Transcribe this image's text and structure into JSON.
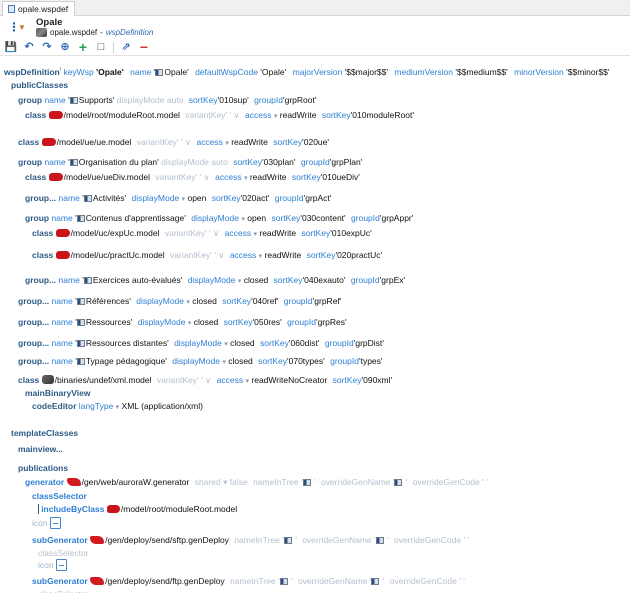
{
  "tab": {
    "label": "opale.wspdef"
  },
  "header": {
    "title": "Opale",
    "doc_name": "opale.wspdef",
    "doc_subtitle": "wspDefinition"
  },
  "root": {
    "tag": "wspDefinition",
    "keyWsp": "Opale",
    "name": "Opale",
    "defaultWspCode": "Opale",
    "majorVersion": "$$major$$",
    "mediumVersion": "$$medium$$",
    "minorVersion": "$$minor$$"
  },
  "labels": {
    "publicClasses": "publicClasses",
    "templateClasses": "templateClasses",
    "mainview": "mainview...",
    "publications": "publications",
    "group": "group",
    "group_trunc": "group...",
    "class": "class",
    "mainBinaryView": "mainBinaryView",
    "codeEditor": "codeEditor",
    "classSelector": "classSelector",
    "includeByClass": "includeByClass",
    "generator": "generator",
    "subGenerator": "subGenerator",
    "icon": "icon",
    "empty_q": "' '",
    "chev": "∨",
    "caret": "▾"
  },
  "attrs": {
    "name": "name",
    "displayMode": "displayMode",
    "sortKey": "sortKey",
    "groupId": "groupId",
    "variantKey": "variantKey",
    "access": "access",
    "langType": "langType",
    "keyWsp": "keyWsp",
    "defaultWspCode": "defaultWspCode",
    "majorVersion": "majorVersion",
    "mediumVersion": "mediumVersion",
    "minorVersion": "minorVersion",
    "shared": "shared",
    "nameInTree": "nameInTree",
    "overrideGenName": "overrideGenName",
    "overrideGenCode": "overrideGenCode"
  },
  "groups": {
    "supports": {
      "name": "Supports",
      "displayMode": "auto",
      "sortKey": "010sup",
      "groupId": "grpRoot"
    },
    "plan": {
      "name": "Organisation du plan",
      "displayMode": "auto",
      "sortKey": "030plan",
      "groupId": "grpPlan"
    },
    "activites": {
      "name": "Activités",
      "displayMode": "open",
      "sortKey": "020act",
      "groupId": "grpAct"
    },
    "appr": {
      "name": "Contenus d'apprentissage",
      "displayMode": "open",
      "sortKey": "030content",
      "groupId": "grpAppr"
    },
    "exos": {
      "name": "Exercices auto-évalués",
      "displayMode": "closed",
      "sortKey": "040exauto",
      "groupId": "grpEx"
    },
    "refs": {
      "name": "Références",
      "displayMode": "closed",
      "sortKey": "040ref",
      "groupId": "grpRef"
    },
    "res": {
      "name": "Ressources",
      "displayMode": "closed",
      "sortKey": "050res",
      "groupId": "grpRes"
    },
    "dist": {
      "name": "Ressources distantes",
      "displayMode": "closed",
      "sortKey": "060dist",
      "groupId": "grpDist"
    },
    "types": {
      "name": "Typage pédagogique",
      "displayMode": "closed",
      "sortKey": "070types",
      "groupId": "types"
    }
  },
  "classes": {
    "moduleRoot": {
      "path": "/model/root/moduleRoot.model",
      "access": "readWrite",
      "sortKey": "010moduleRoot"
    },
    "ue": {
      "path": "/model/ue/ue.model",
      "access": "readWrite",
      "sortKey": "020ue"
    },
    "ueDiv": {
      "path": "/model/ue/ueDiv.model",
      "access": "readWrite",
      "sortKey": "010ueDiv"
    },
    "expUc": {
      "path": "/model/uc/expUc.model",
      "access": "readWrite",
      "sortKey": "010expUc"
    },
    "practUc": {
      "path": "/model/uc/practUc.model",
      "access": "readWrite",
      "sortKey": "020practUc"
    },
    "xml": {
      "path": "/binaries/undef/xml.model",
      "access": "readWriteNoCreator",
      "sortKey": "090xml"
    }
  },
  "codeEditor": {
    "langType": "XML (application/xml)"
  },
  "generators": {
    "aurora": {
      "path": "/gen/web/auroraW.generator",
      "shared": "false"
    },
    "include_path": "/model/root/moduleRoot.model",
    "sftp": {
      "path": "/gen/deploy/send/sftp.genDeploy"
    },
    "ftp": {
      "path": "/gen/deploy/send/ftp.genDeploy"
    }
  }
}
